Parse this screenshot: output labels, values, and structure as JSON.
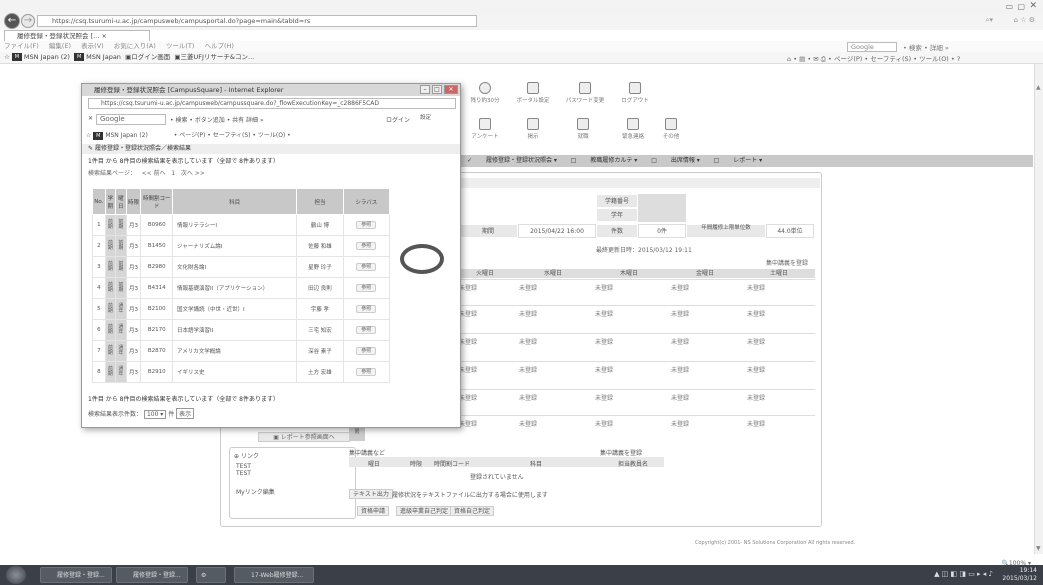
{
  "browser": {
    "url": "https://csq.tsurumi-u.ac.jp/campusweb/campusportal.do?page=main&tabId=rs",
    "tab_title": "履修登録・登録状況照会 [... ×",
    "menu": [
      "ファイル(F)",
      "編集(E)",
      "表示(V)",
      "お気に入り(A)",
      "ツール(T)",
      "ヘルプ(H)"
    ],
    "favorites": [
      "MSN Japan (2)",
      "MSN Japan",
      "ログイン画面",
      "三菱UFJリサーチ&コン..."
    ],
    "search_engine": "Google",
    "toolbar_right": "• 検索 • 詳細 »",
    "command_bar": "• ページ(P) • セーフティ(S) • ツール(O) •",
    "zoom": "100%"
  },
  "portal": {
    "top_icons": [
      "残り約30分",
      "ポータル設定",
      "パスワード変更",
      "ログアウト"
    ],
    "mid_icons": [
      "アンケート",
      "掲示",
      "就職",
      "緊急連絡",
      "その他"
    ],
    "nav": [
      "履修登録・登録状況照会",
      "教職履修カルテ",
      "出席情報",
      "レポート"
    ],
    "student_no_label": "学籍番号",
    "name_label": "学年",
    "period_label": "期間",
    "period_value": "2015/04/22 16:00",
    "count_label": "件数",
    "count_value": "0件",
    "cap_label": "年間履修上限単位数",
    "cap_value": "44.0単位",
    "updated": "最終更新日時：2015/03/12 19:11",
    "intensive_register": "集中講義を登録",
    "days": [
      "火曜日",
      "水曜日",
      "木曜日",
      "金曜日",
      "土曜日"
    ],
    "unregistered": "未登録",
    "report_link": "レポート参照画面へ",
    "link_header": "リンク",
    "link_items": [
      "TEST",
      "TEST"
    ],
    "mylink_edit": "Myリンク編集",
    "intensive_title": "集中講義など",
    "intensive_register2": "集中講義を登録",
    "intensive_cols": [
      "曜日",
      "時限",
      "時間割コード",
      "科目",
      "担当教員名"
    ],
    "intensive_empty": "登録されていません",
    "text_output_btn": "テキスト出力",
    "text_output_desc": "履修状況をテキストファイルに出力する場合に使用します",
    "btn_apply": "資格申請",
    "btn_self1": "進級卒業自己判定",
    "btn_self2": "資格自己判定",
    "copyright": "Copyright(c) 2001- NS Solutions Corporation All rights reserved."
  },
  "popup": {
    "title": "履修登録・登録状況照会 [CampusSquare] - Internet Explorer",
    "url": "https://csq.tsurumi-u.ac.jp/campusweb/campussquare.do?_flowExecutionKey=_c2886F5CAD",
    "search_engine": "Google",
    "toolbar": "• 検索 • ボタン追加 • 共有 詳細 »",
    "login_label": "ログイン",
    "settings_label": "設定",
    "favorites": "MSN Japan (2)",
    "command_bar": "• ページ(P) • セーフティ(S) • ツール(O) •",
    "breadcrumb": "履修登録・登録状況照会／検索結果",
    "count_text": "1件目 から 8件目の検索結果を表示しています（全部で 8件あります）",
    "pager_label": "検索結果ページ：",
    "pager_prev": "<< 前へ",
    "pager_page": "1",
    "pager_next": "次へ >>",
    "col_headers": [
      "No.",
      "学期",
      "曜日",
      "時限",
      "時間割コード",
      "科目",
      "担当",
      "シラバス"
    ],
    "rows": [
      {
        "no": "1",
        "term": "前期",
        "mode": "前期",
        "period": "月3",
        "code": "B0960",
        "subject": "情報リテラシーI",
        "teacher": "鶴山 博",
        "syllabus": "参照"
      },
      {
        "no": "2",
        "term": "前期",
        "mode": "前期",
        "period": "月3",
        "code": "B1450",
        "subject": "ジャーナリズム論I",
        "teacher": "佐藤 和雄",
        "syllabus": "参照"
      },
      {
        "no": "3",
        "term": "前期",
        "mode": "前期",
        "period": "月3",
        "code": "B2980",
        "subject": "文化財各論I",
        "teacher": "星野 玲子",
        "syllabus": "参照"
      },
      {
        "no": "4",
        "term": "前期",
        "mode": "前期",
        "period": "月3",
        "code": "B4314",
        "subject": "情報基礎演習II（アプリケーション）",
        "teacher": "田辺 良則",
        "syllabus": "参照"
      },
      {
        "no": "5",
        "term": "前期",
        "mode": "通年",
        "period": "月3",
        "code": "B2100",
        "subject": "国文学講読（中世・近世）I",
        "teacher": "宇藤 孝",
        "syllabus": "参照"
      },
      {
        "no": "6",
        "term": "前期",
        "mode": "通年",
        "period": "月3",
        "code": "B2170",
        "subject": "日本語学演習II",
        "teacher": "三宅 知宏",
        "syllabus": "参照"
      },
      {
        "no": "7",
        "term": "前期",
        "mode": "通年",
        "period": "月3",
        "code": "B2870",
        "subject": "アメリカ文学概論",
        "teacher": "深谷 素子",
        "syllabus": "参照"
      },
      {
        "no": "8",
        "term": "前期",
        "mode": "通年",
        "period": "月3",
        "code": "B2910",
        "subject": "イギリス史",
        "teacher": "土方 宏雄",
        "syllabus": "参照"
      }
    ],
    "perpage_label": "検索結果表示件数：",
    "perpage_value": "100",
    "perpage_unit": "件",
    "perpage_btn": "表示"
  },
  "taskbar": {
    "items": [
      "履修登録・登録...",
      "履修登録・登録...",
      "",
      "17-Web履修登録..."
    ],
    "clock_time": "19:14",
    "clock_date": "2015/03/12"
  }
}
